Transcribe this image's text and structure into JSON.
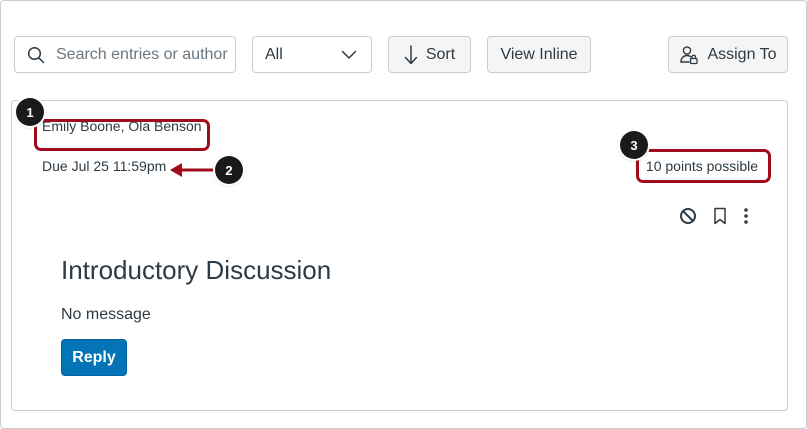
{
  "toolbar": {
    "search_placeholder": "Search entries or author",
    "filter_value": "All",
    "sort_label": "Sort",
    "view_inline_label": "View Inline",
    "assign_to_label": "Assign To"
  },
  "discussion": {
    "authors": "Emily Boone, Ola Benson",
    "due_date": "Due Jul 25 11:59pm",
    "points": "10 points possible",
    "title": "Introductory Discussion",
    "message": "No message",
    "reply_label": "Reply"
  },
  "callouts": [
    "1",
    "2",
    "3"
  ],
  "colors": {
    "primary_button": "#0374b5",
    "callout_outline": "#a10c1c",
    "text": "#2d3b45",
    "border": "#c7cdd1"
  },
  "icons": [
    "search-icon",
    "chevron-down-icon",
    "arrow-down-icon",
    "assign-user-icon",
    "unpublish-icon",
    "bookmark-icon",
    "more-options-icon",
    "arrow-left-icon"
  ]
}
